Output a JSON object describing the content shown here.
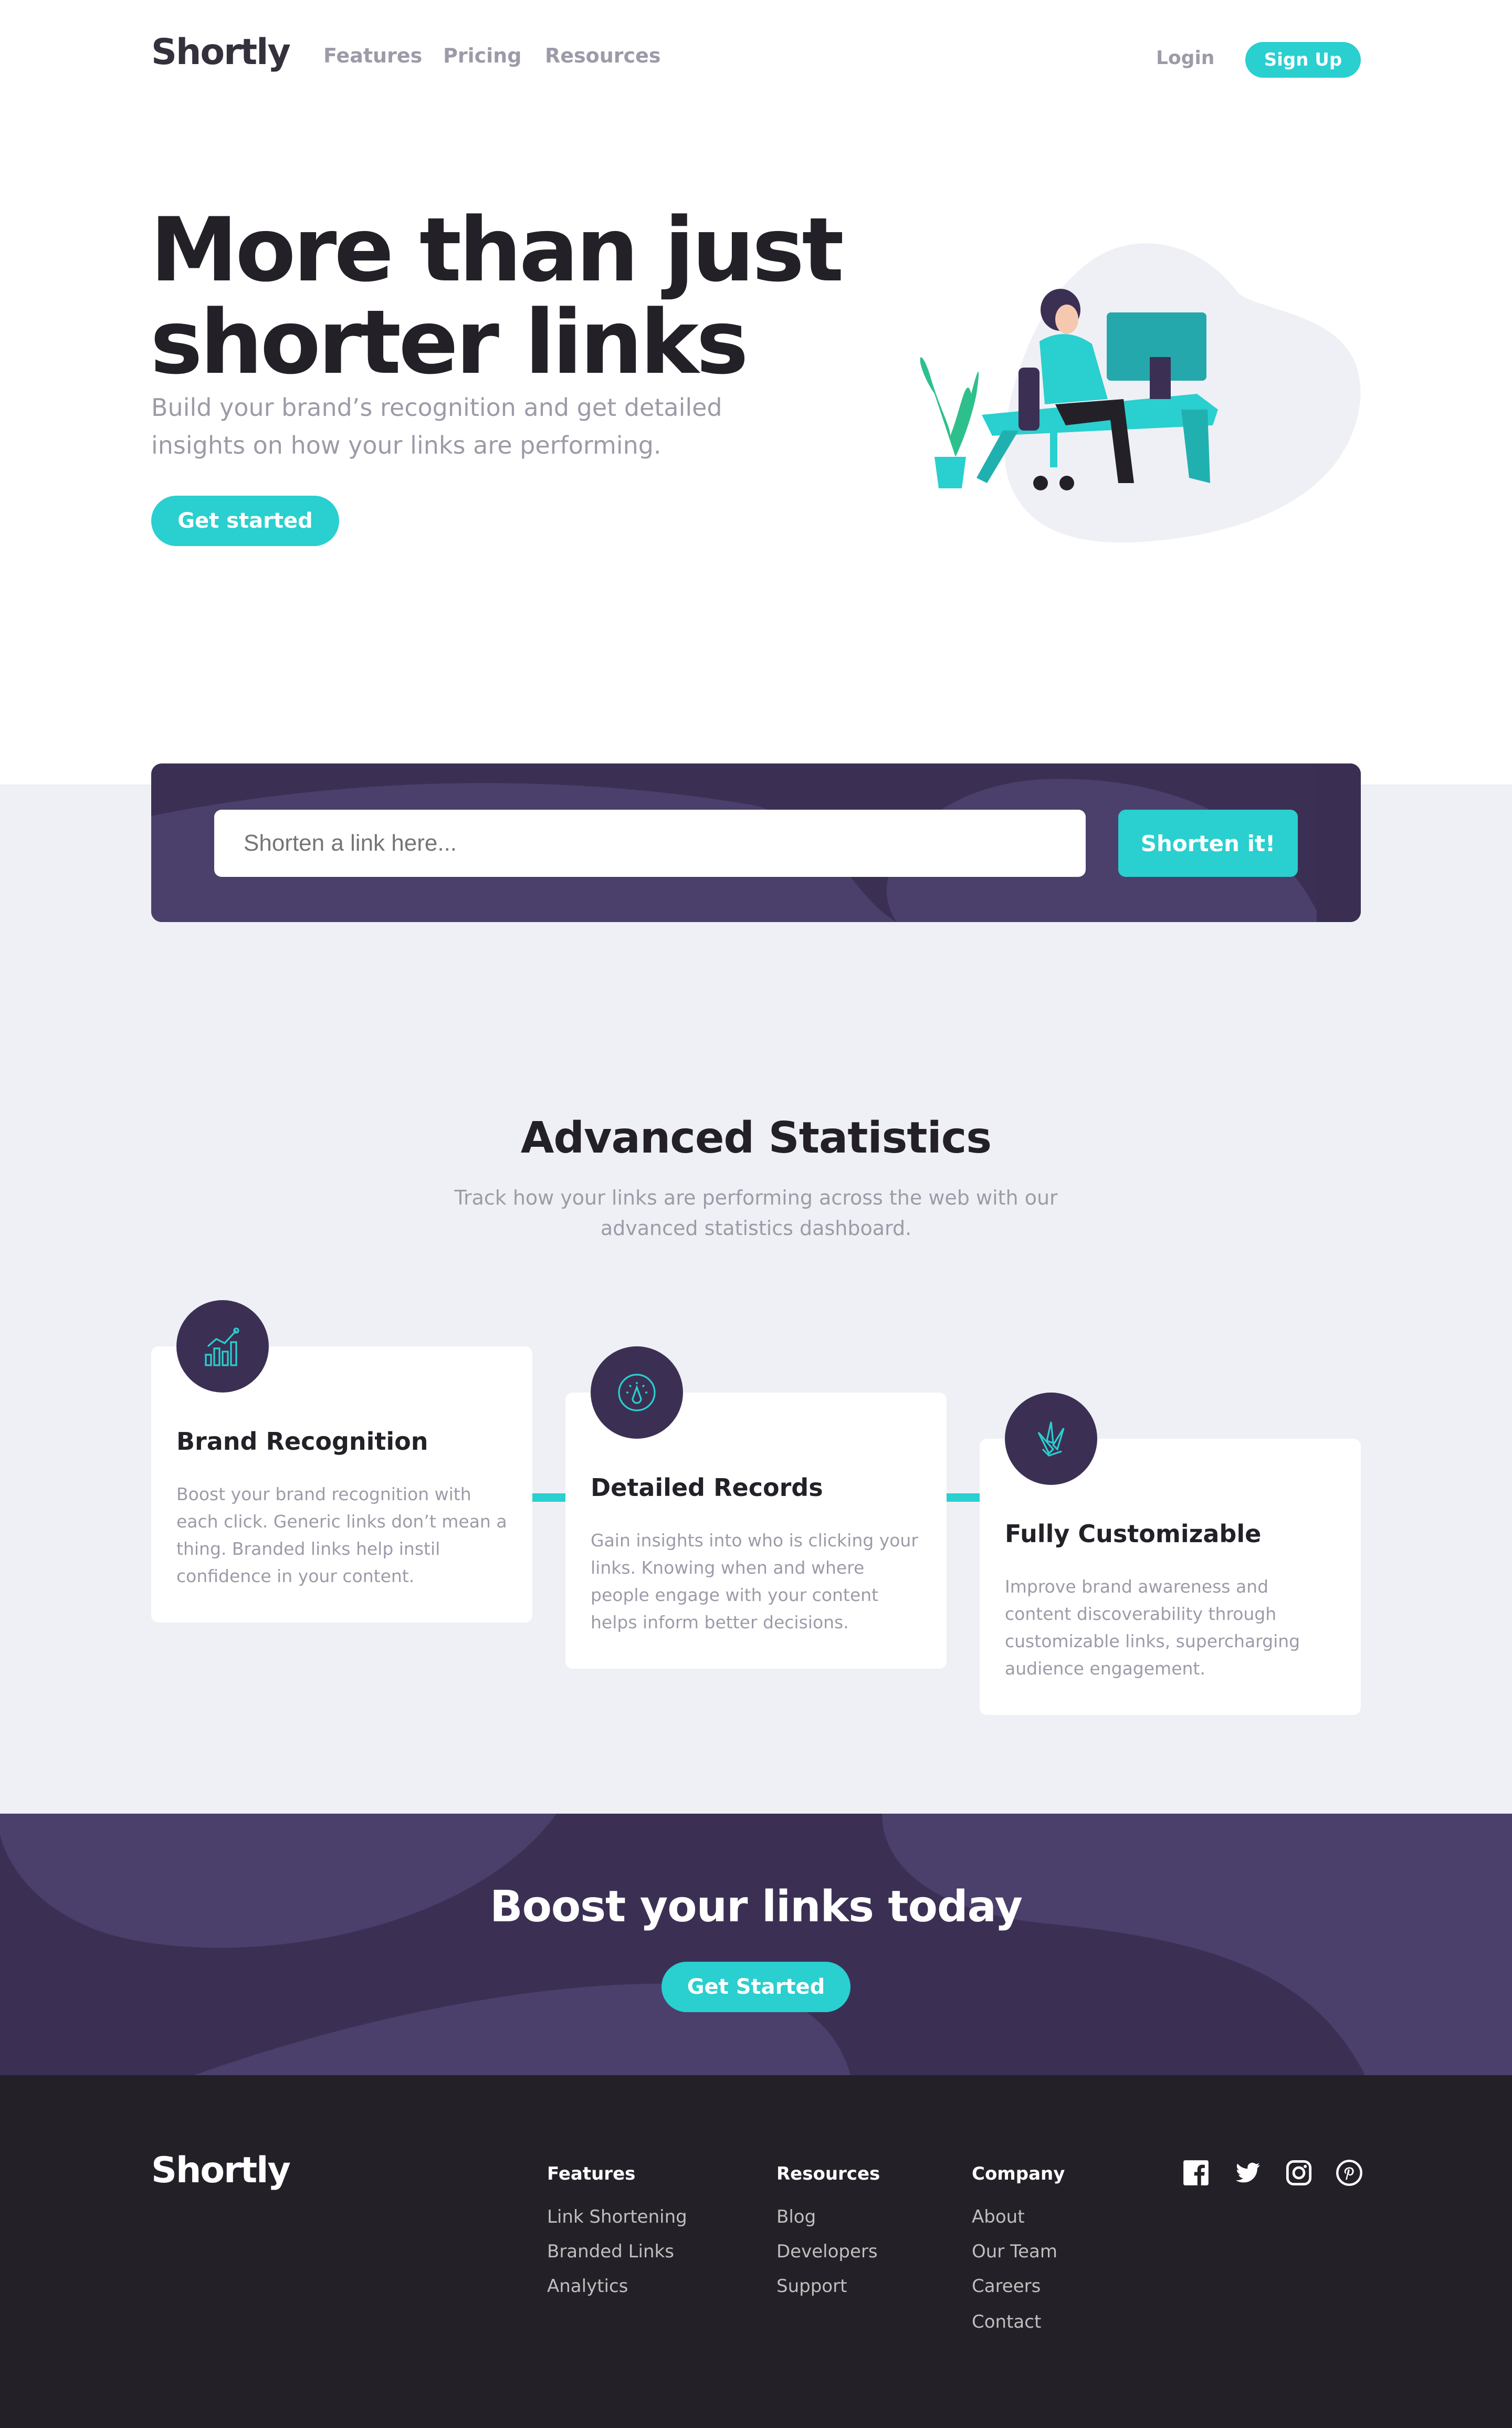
{
  "brand": "Shortly",
  "nav": {
    "links": [
      "Features",
      "Pricing",
      "Resources"
    ],
    "login": "Login",
    "signup": "Sign Up"
  },
  "hero": {
    "title_line1": "More than just",
    "title_line2": "shorter links",
    "subtitle": "Build your brand’s recognition and get detailed insights on how your links are performing.",
    "cta": "Get started"
  },
  "shorten": {
    "placeholder": "Shorten a link here...",
    "button": "Shorten it!"
  },
  "stats": {
    "title": "Advanced Statistics",
    "subtitle": "Track how your links are performing across the web with our advanced statistics dashboard.",
    "cards": [
      {
        "title": "Brand Recognition",
        "text": "Boost your brand recognition with each click. Generic links don’t mean a thing. Branded links help instil confidence in your content.",
        "icon": "bar-chart-icon"
      },
      {
        "title": "Detailed Records",
        "text": "Gain insights into who is clicking your links. Knowing when and where people engage with your content helps inform better decisions.",
        "icon": "gauge-icon"
      },
      {
        "title": "Fully Customizable",
        "text": "Improve brand awareness and content discoverability through customizable links, supercharging audience engagement.",
        "icon": "brushes-icon"
      }
    ]
  },
  "boost": {
    "title": "Boost your links today",
    "cta": "Get Started"
  },
  "footer": {
    "columns": [
      {
        "title": "Features",
        "links": [
          "Link Shortening",
          "Branded Links",
          "Analytics"
        ]
      },
      {
        "title": "Resources",
        "links": [
          "Blog",
          "Developers",
          "Support"
        ]
      },
      {
        "title": "Company",
        "links": [
          "About",
          "Our Team",
          "Careers",
          "Contact"
        ]
      }
    ],
    "social": [
      "facebook-icon",
      "twitter-icon",
      "instagram-icon",
      "pinterest-icon"
    ]
  },
  "colors": {
    "cyan": "#2acfcf",
    "dark_violet": "#3b3054",
    "very_dark_violet": "#232127",
    "grayish_violet": "#9e9aa8",
    "light_bg": "#eff0f5"
  }
}
